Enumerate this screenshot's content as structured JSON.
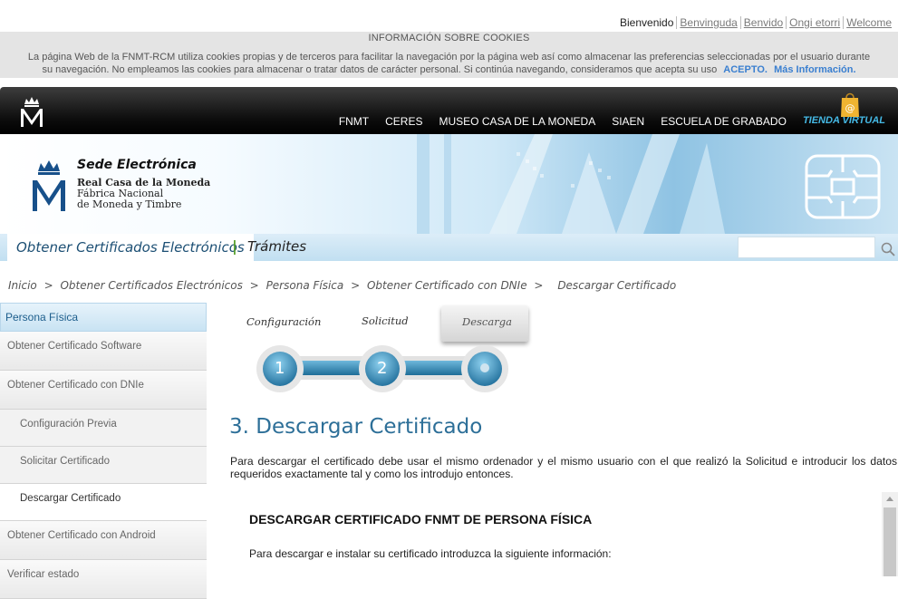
{
  "langbar": {
    "current": "Bienvenido",
    "links": [
      "Benvinguda",
      "Benvido",
      "Ongi etorri",
      "Welcome"
    ]
  },
  "cookie": {
    "title": "INFORMACIÓN SOBRE COOKIES",
    "body": "La página Web de la FNMT-RCM utiliza cookies propias y de terceros para facilitar la navegación por la página web así como almacenar las preferencias seleccionadas por el usuario durante su navegación. No empleamos las cookies para almacenar o tratar datos de carácter personal. Si continúa navegando, consideramos que acepta su uso",
    "accept": "ACEPTO.",
    "more": "Más Información."
  },
  "topnav": {
    "links": [
      "FNMT",
      "CERES",
      "MUSEO CASA DE LA MONEDA",
      "SIAEN",
      "ESCUELA DE GRABADO"
    ],
    "store": "TIENDA VIRTUAL"
  },
  "banner": {
    "sede": "Sede Electrónica",
    "org_line1": "Real Casa de la Moneda",
    "org_line2": "Fábrica Nacional",
    "org_line3": "de Moneda y Timbre"
  },
  "subbar": {
    "tab_main": "Obtener Certificados Electrónicos",
    "separator": "|",
    "tab_secondary": "Trámites",
    "search_placeholder": ""
  },
  "breadcrumb": [
    "Inicio",
    ">",
    "Obtener Certificados Electrónicos",
    ">",
    "Persona Física",
    ">",
    "Obtener Certificado con DNIe",
    ">",
    "Descargar Certificado"
  ],
  "sidebar": {
    "header": "Persona Física",
    "items": [
      {
        "label": "Obtener Certificado Software"
      },
      {
        "label": "Obtener Certificado con DNIe"
      },
      {
        "label": "Configuración Previa"
      },
      {
        "label": "Solicitar Certificado"
      },
      {
        "label": "Descargar Certificado"
      },
      {
        "label": "Obtener Certificado con Android"
      },
      {
        "label": "Verificar estado"
      }
    ]
  },
  "steps": {
    "labels": [
      "Configuración",
      "Solicitud",
      "Descarga"
    ],
    "numbers": [
      "1",
      "2"
    ],
    "current_step": 3
  },
  "main": {
    "heading": "3. Descargar Certificado",
    "intro": "Para descargar el certificado debe usar el mismo ordenador y el mismo usuario con el que realizó la Solicitud e introducir los datos requeridos exactamente tal y como los introdujo entonces.",
    "panel_title": "DESCARGAR CERTIFICADO FNMT DE PERSONA FÍSICA",
    "panel_text": "Para descargar e instalar su certificado introduzca la siguiente información:"
  }
}
